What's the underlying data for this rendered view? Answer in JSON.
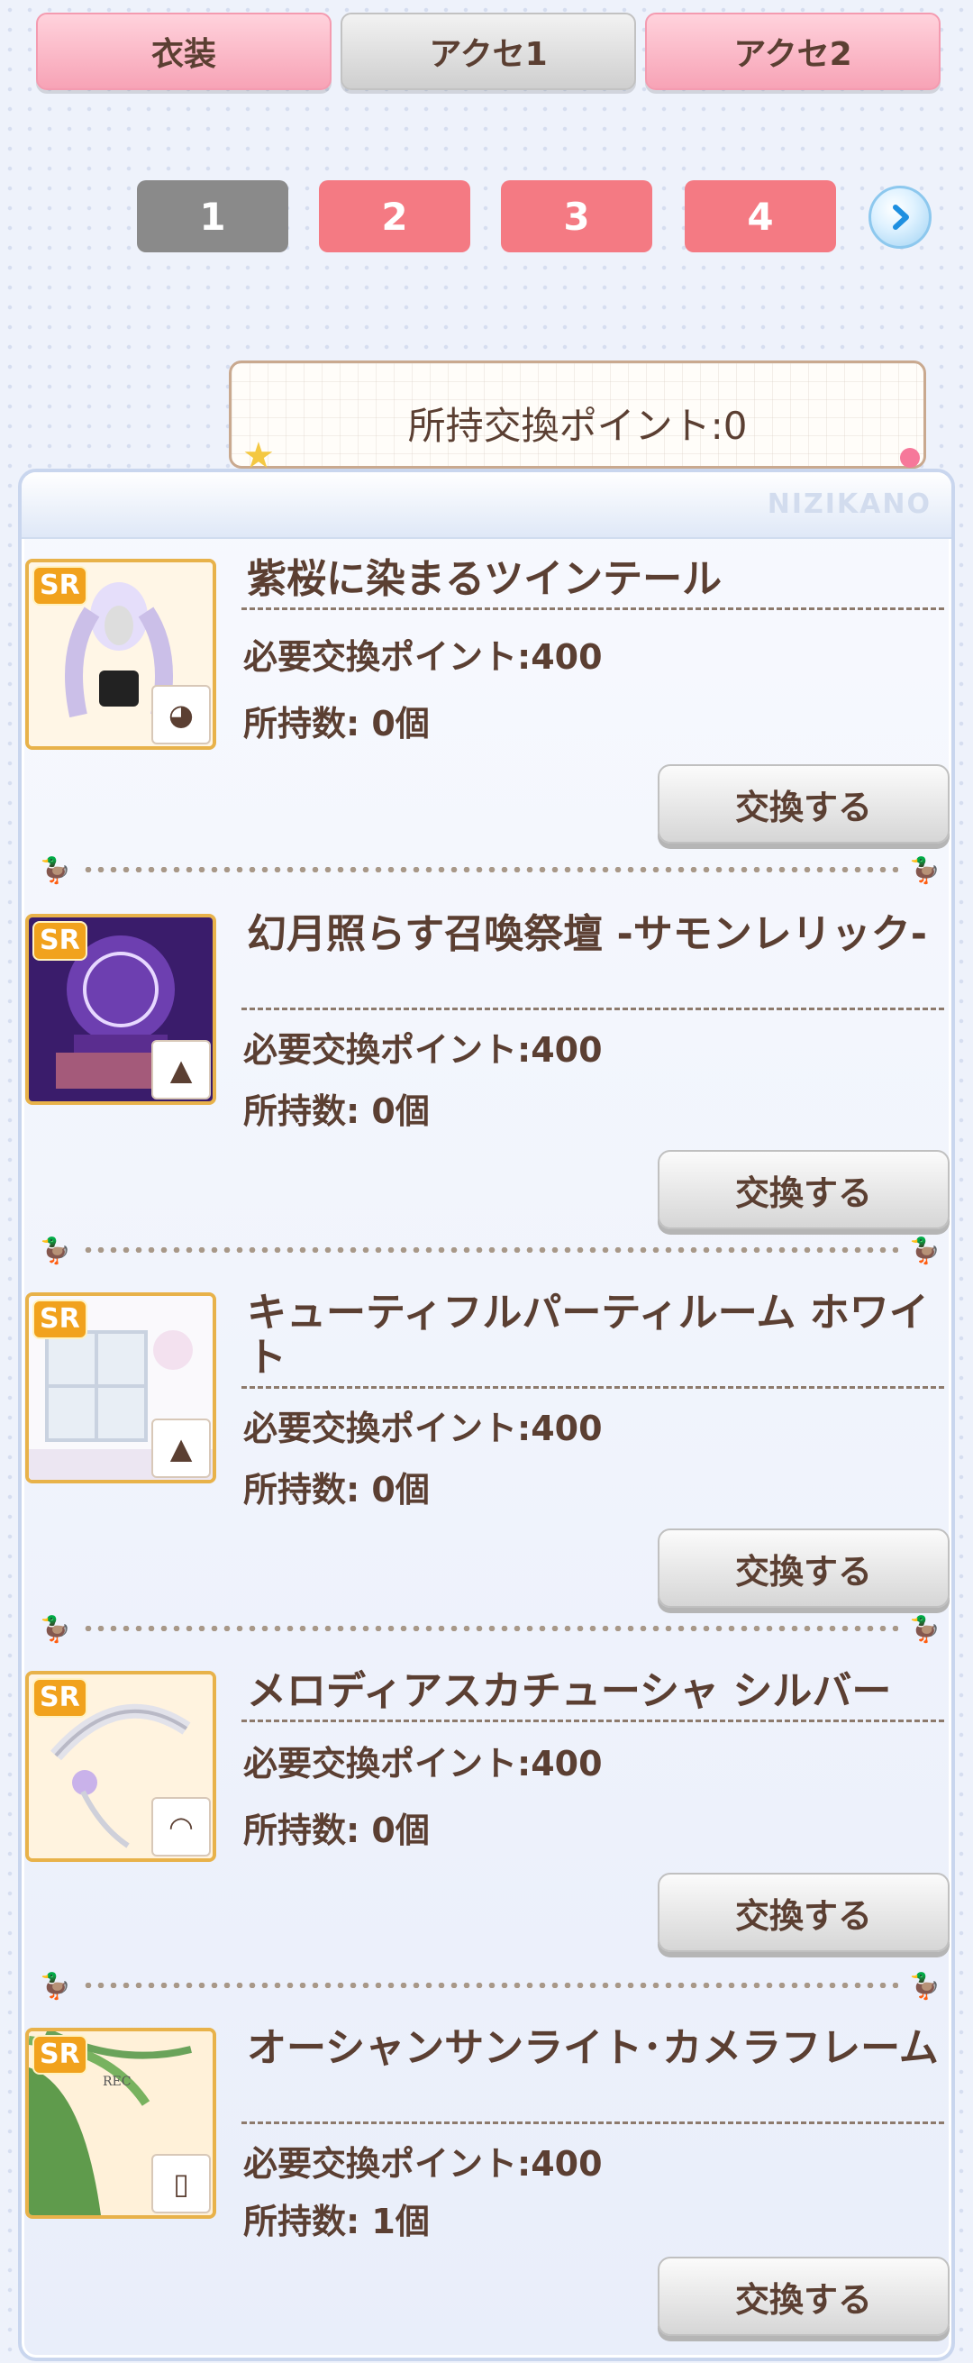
{
  "tabs": [
    {
      "label": "衣装",
      "style": "pink"
    },
    {
      "label": "アクセ1",
      "style": "gray"
    },
    {
      "label": "アクセ2",
      "style": "pink"
    }
  ],
  "pagination": {
    "pages": [
      "1",
      "2",
      "3",
      "4"
    ],
    "current": "1",
    "next_icon": "chevron-right-icon"
  },
  "points": {
    "label": "所持交換ポイント:0"
  },
  "brand": "NIZIKANO",
  "rarity": "SR",
  "items": [
    {
      "title": "紫桜に染まるツインテール",
      "required": "必要交換ポイント:400",
      "owned": "所持数: 0個",
      "button": "交換する",
      "category_icon": "hair-icon",
      "thumb_colors": [
        "#f5f0ff",
        "#c7bde0"
      ]
    },
    {
      "title": "幻月照らす召喚祭壇 -サモンレリック-",
      "required": "必要交換ポイント:400",
      "owned": "所持数: 0個",
      "button": "交換する",
      "category_icon": "background-icon",
      "thumb_colors": [
        "#6e3fa8",
        "#2d1553"
      ]
    },
    {
      "title": "キューティフルパーティルーム ホワイト",
      "required": "必要交換ポイント:400",
      "owned": "所持数: 0個",
      "button": "交換する",
      "category_icon": "background-icon",
      "thumb_colors": [
        "#ffffff",
        "#e4e4ee"
      ]
    },
    {
      "title": "メロディアスカチューシャ シルバー",
      "required": "必要交換ポイント:400",
      "owned": "所持数: 0個",
      "button": "交換する",
      "category_icon": "headband-icon",
      "thumb_colors": [
        "#fff7ea",
        "#f2dcb5"
      ]
    },
    {
      "title": "オーシャンサンライト･カメラフレーム",
      "required": "必要交換ポイント:400",
      "owned": "所持数: 1個",
      "button": "交換する",
      "category_icon": "frame-icon",
      "thumb_colors": [
        "#fff4e0",
        "#6aa35a"
      ]
    }
  ]
}
